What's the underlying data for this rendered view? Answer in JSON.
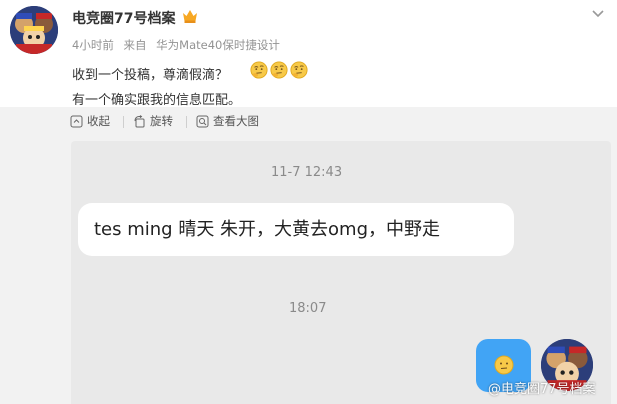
{
  "post": {
    "username": "电竞圈77号档案",
    "time": "4小时前",
    "source_prefix": "来自",
    "source_device": "华为Mate40保时捷设计",
    "text_line1": "收到一个投稿，尊滴假滴？",
    "text_line2": "有一个确实跟我的信息匹配。",
    "emoji_icons": [
      "thinking-face-icon",
      "thinking-face-icon",
      "thinking-face-icon"
    ]
  },
  "image_toolbar": {
    "collapse_label": "收起",
    "rotate_label": "旋转",
    "view_large_label": "查看大图"
  },
  "screenshot": {
    "timestamp1": "11-7 12:43",
    "message_text": "tes ming 晴天 朱开，大黄去omg，中野走",
    "timestamp2": "18:07",
    "watermark": "@电竞圈77号档案"
  },
  "colors": {
    "accent_blue": "#41a4f5",
    "crown_orange": "#f7a823",
    "emoji_yellow": "#f7c948"
  }
}
